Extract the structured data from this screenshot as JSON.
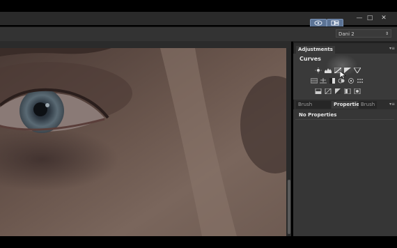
{
  "window": {
    "minimize_label": "—",
    "maximize_label": "□",
    "close_label": "✕"
  },
  "optionsbar": {
    "workspace_value": "Dani 2"
  },
  "panels": {
    "adjustments": {
      "tab_label": "Adjustments",
      "section_title": "Curves"
    },
    "properties_group": {
      "tabs": [
        "Brush Presets",
        "Properties",
        "Brush"
      ],
      "active_tab": "Properties",
      "content": "No Properties"
    }
  },
  "icons": [
    "brightness-icon",
    "levels-icon",
    "curves-icon",
    "exposure-icon",
    "vibrance-icon",
    "hue-saturation-icon",
    "color-balance-icon",
    "black-white-icon",
    "photo-filter-icon",
    "channel-mixer-icon",
    "color-lookup-icon",
    "invert-icon",
    "posterize-icon",
    "threshold-icon",
    "gradient-map-icon",
    "selective-color-icon"
  ],
  "colors": {
    "accent": "#5b7395",
    "panel_bg": "#2d2d2d"
  }
}
